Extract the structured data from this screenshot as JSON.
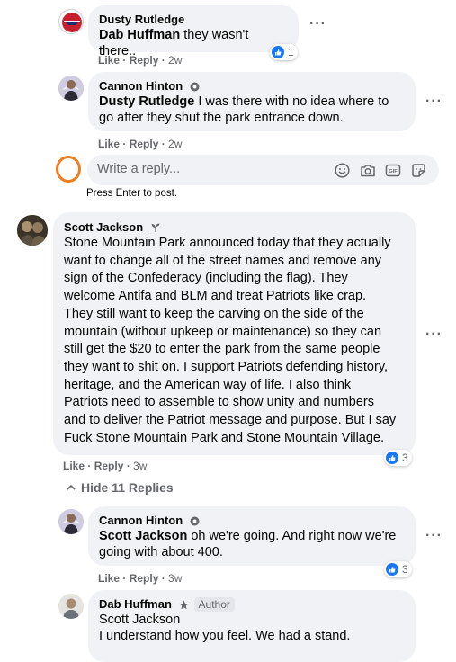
{
  "comments": [
    {
      "author": "Dusty Rutledge",
      "mention": "Dab Huffman",
      "text": " they wasn't there..",
      "actions": {
        "like": "Like",
        "reply": "Reply",
        "time": "2w"
      },
      "reactions": "1"
    },
    {
      "author": "Cannon Hinton",
      "mention": "Dusty Rutledge",
      "text_line1": " I was there with no idea where to",
      "text_line2": "go after they shut the park entrance down.",
      "actions": {
        "like": "Like",
        "reply": "Reply",
        "time": "2w"
      }
    }
  ],
  "reply_box": {
    "placeholder": "Write a reply...",
    "hint": "Press Enter to post.",
    "icons": [
      "emoji-icon",
      "camera-icon",
      "gif-icon",
      "sticker-icon"
    ]
  },
  "main_comment": {
    "author": "Scott Jackson",
    "lines": [
      "Stone Mountain Park announced today that they actually",
      "want to change all of the street names and remove any",
      "sign of the Confederacy (including the flag). They",
      "welcome Antifa and BLM and treat Patriots like crap.",
      "They still want to keep the carving on the side of the",
      "mountain (without upkeep or maintenance) so they can",
      "still get the $20 to enter the park from the same people",
      "they want to shit on. I support Patriots defending history,",
      "heritage, and the American way of life. I also think",
      "Patriots need to assemble to show unity and numbers",
      "and to deliver the Patriot message and purpose. But I say",
      "Fuck Stone Mountain Park and Stone Mountain Village."
    ],
    "actions": {
      "like": "Like",
      "reply": "Reply",
      "time": "3w"
    },
    "reactions": "3",
    "hide_replies": "Hide 11 Replies"
  },
  "replies": [
    {
      "author": "Cannon Hinton",
      "mention": "Scott Jackson",
      "text_line1": " oh we're going. And right now we're",
      "text_line2": "going with about 400.",
      "actions": {
        "like": "Like",
        "reply": "Reply",
        "time": "3w"
      },
      "reactions": "3"
    },
    {
      "author": "Dab Huffman",
      "author_badge": "Author",
      "line1": "Scott Jackson",
      "line2": "I understand how you feel. We had a stand."
    }
  ],
  "colors": {
    "bubble": "#f0f2f5",
    "secondary_text": "#65676b",
    "like_blue": "#1877f2",
    "highlight_circle": "#f07c1d"
  }
}
